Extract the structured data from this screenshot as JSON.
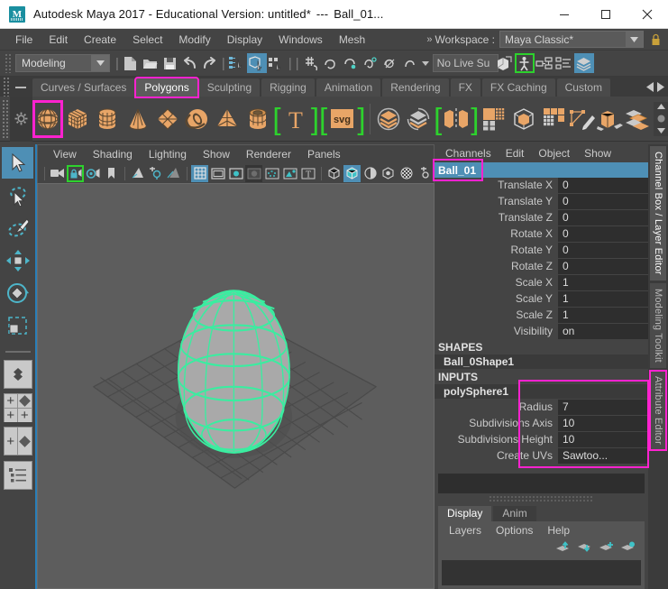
{
  "window": {
    "title": "Autodesk Maya 2017 - Educational Version: untitled*",
    "title_sep": "---",
    "title_doc": "Ball_01...",
    "logo_text": "M",
    "minimize": "minimize-button",
    "maximize": "maximize-button",
    "close": "close-button"
  },
  "menubar": {
    "items": [
      "File",
      "Edit",
      "Create",
      "Select",
      "Modify",
      "Display",
      "Windows",
      "Mesh"
    ],
    "workspace_chevron": "»",
    "workspace_label": "Workspace :",
    "workspace_value": "Maya Classic*"
  },
  "statusline": {
    "mode": "Modeling",
    "live_surface": "No Live Su",
    "icons": [
      "new-scene-icon",
      "open-scene-icon",
      "save-scene-icon",
      "undo-icon",
      "redo-icon",
      "select-by-hierarchy-icon",
      "select-by-object-icon",
      "select-by-component-icon",
      "snap-to-grid-icon",
      "snap-to-curve-icon",
      "snap-to-point-icon",
      "snap-to-projected-center-icon",
      "snap-to-view-plane-icon",
      "make-live-icon",
      "render-view-icon",
      "rig-icon",
      "input-connections-icon",
      "output-connections-icon",
      "layer-editor-icon"
    ]
  },
  "shelf": {
    "tabs": [
      "Curves / Surfaces",
      "Polygons",
      "Sculpting",
      "Rigging",
      "Animation",
      "Rendering",
      "FX",
      "FX Caching",
      "Custom"
    ],
    "active_tab": "Polygons",
    "highlighted_tab": "Polygons",
    "icons": [
      "poly-sphere-icon",
      "poly-cube-icon",
      "poly-cylinder-icon",
      "poly-cone-icon",
      "poly-platonic-icon",
      "poly-torus-icon",
      "poly-pyramid-icon",
      "poly-pipe-icon",
      "poly-type-icon",
      "poly-svg-icon",
      "combine-icon",
      "separate-icon",
      "boolean-icon",
      "smooth-icon",
      "multi-cut-icon",
      "extrude-icon",
      "bevel-icon",
      "bridge-icon",
      "mirror-icon",
      "target-weld-icon"
    ],
    "highlighted_icon": "poly-sphere-icon",
    "gear": "shelf-options-gear-icon"
  },
  "toolbox": {
    "tools": [
      "select-tool-icon",
      "lasso-select-tool-icon",
      "paint-select-tool-icon",
      "move-tool-icon",
      "rotate-tool-icon",
      "scale-tool-icon"
    ],
    "selected_tool": "select-tool-icon",
    "layouts": [
      "single-perspective-layout",
      "four-view-layout",
      "two-pane-side-layout",
      "outliner-persp-layout"
    ],
    "highlighted_layout": "four-view-layout"
  },
  "viewport": {
    "panel_menu": [
      "View",
      "Shading",
      "Lighting",
      "Show",
      "Renderer",
      "Panels"
    ],
    "toolbar_icons": [
      "select-camera-icon",
      "lock-camera-icon",
      "camera-attributes-icon",
      "bookmark-icon",
      "image-plane-icon",
      "two-sided-lighting-icon",
      "shadows-icon",
      "grid-icon",
      "film-gate-icon",
      "resolution-gate-icon",
      "gate-mask-icon",
      "xray-icon",
      "xray-joints-icon",
      "texture-icon",
      "wireframe-shading-icon",
      "smooth-shading-icon",
      "shaded-textured-icon",
      "use-all-lights-icon",
      "screen-space-ao-icon",
      "multisample-icon"
    ],
    "active_toolbar_icons": [
      "grid-icon",
      "smooth-shading-icon"
    ],
    "highlighted_toolbar_icon": "lock-camera-icon",
    "scene": {
      "object": "Ball_01",
      "selected": true,
      "wireframe_color": "#3aeda0",
      "background_color": "#5d5d5d"
    }
  },
  "channel_box": {
    "menu": [
      "Channels",
      "Edit",
      "Object",
      "Show"
    ],
    "node_name": "Ball_01",
    "transform_attributes": [
      {
        "label": "Translate X",
        "value": "0"
      },
      {
        "label": "Translate Y",
        "value": "0"
      },
      {
        "label": "Translate Z",
        "value": "0"
      },
      {
        "label": "Rotate X",
        "value": "0"
      },
      {
        "label": "Rotate Y",
        "value": "0"
      },
      {
        "label": "Rotate Z",
        "value": "0"
      },
      {
        "label": "Scale X",
        "value": "1"
      },
      {
        "label": "Scale Y",
        "value": "1"
      },
      {
        "label": "Scale Z",
        "value": "1"
      },
      {
        "label": "Visibility",
        "value": "on"
      }
    ],
    "shapes_header": "SHAPES",
    "shape_node": "Ball_0Shape1",
    "inputs_header": "INPUTS",
    "input_node": "polySphere1",
    "input_attributes": [
      {
        "label": "Radius",
        "value": "7"
      },
      {
        "label": "Subdivisions Axis",
        "value": "10"
      },
      {
        "label": "Subdivisions Height",
        "value": "10"
      },
      {
        "label": "Create UVs",
        "value": "Sawtoo..."
      }
    ]
  },
  "layer_editor": {
    "tabs": [
      "Display",
      "Anim"
    ],
    "active_tab": "Display",
    "menu": [
      "Layers",
      "Options",
      "Help"
    ],
    "icons": [
      "move-layer-up-icon",
      "move-layer-down-icon",
      "new-layer-icon",
      "new-layer-from-selected-icon"
    ]
  },
  "vertical_tabs": {
    "items": [
      "Channel Box / Layer Editor",
      "Modeling Toolkit",
      "Attribute Editor"
    ],
    "selected": "Channel Box / Layer Editor",
    "highlighted": "Attribute Editor"
  },
  "colors": {
    "highlight_magenta": "#ff22d0",
    "highlight_green": "#2dd22d",
    "accent_blue": "#4e8fb5",
    "shelf_orange": "#e8a567",
    "panel_bg": "#444444"
  }
}
